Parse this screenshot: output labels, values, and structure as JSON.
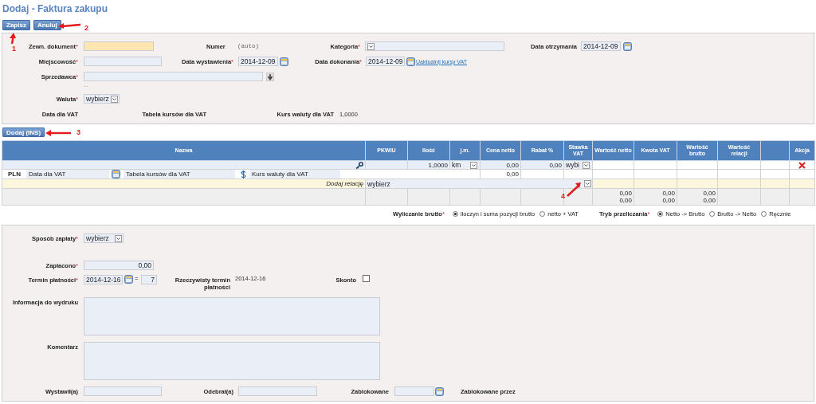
{
  "title": "Dodaj - Faktura zakupu",
  "required_mark": "*",
  "toolbar": [
    {
      "label": "Zapisz"
    },
    {
      "label": "Anuluj"
    }
  ],
  "callouts": [
    {
      "number": "1"
    },
    {
      "number": "2"
    },
    {
      "number": "3"
    },
    {
      "number": "4"
    }
  ],
  "header": {
    "external_document": {
      "label": "Zewn. dokument",
      "required": true
    },
    "number": {
      "label": "Numer",
      "value": "(auto)"
    },
    "category": {
      "label": "Kategoria",
      "required": true
    },
    "received_date": {
      "label": "Data otrzymania",
      "value": "2014-12-09"
    },
    "city": {
      "label": "Miejscowość",
      "required": true
    },
    "issue_date": {
      "label": "Data wystawienia",
      "required": true,
      "value": "2014-12-09"
    },
    "sale_date": {
      "label": "Data dokonania",
      "required": true,
      "value": "2014-12-09"
    },
    "update_rates_link": "Uaktualnij kursy VAT",
    "seller": {
      "label": "Sprzedawca",
      "required": true
    },
    "seller_more": "...",
    "currency": {
      "label": "Waluta",
      "required": true,
      "value": "wybierz"
    },
    "vat_date": {
      "label": "Data dla VAT"
    },
    "vat_rate_table": {
      "label": "Tabela kursów dla VAT"
    },
    "vat_rate": {
      "label": "Kurs waluty dla VAT",
      "value": "1,0000"
    }
  },
  "add_button": "Dodaj (INS)",
  "items_table": {
    "columns": [
      {
        "kind": "text",
        "label": "Nazwa"
      },
      {
        "kind": "text",
        "label": "PKWiU"
      },
      {
        "kind": "text",
        "label": "Ilość"
      },
      {
        "kind": "text",
        "label": "j.m."
      },
      {
        "kind": "text",
        "label": "Cena netto"
      },
      {
        "kind": "text",
        "label": "Rabat %"
      },
      {
        "kind": "text",
        "label": "Stawka VAT"
      },
      {
        "kind": "text",
        "label": "Wartość netto"
      },
      {
        "kind": "text",
        "label": "Kwota VAT"
      },
      {
        "kind": "text",
        "label": "Wartość brutto"
      },
      {
        "kind": "text",
        "label": "Wartość relacji"
      },
      {
        "kind": "blank"
      },
      {
        "kind": "text",
        "label": "Akcja"
      }
    ],
    "item": {
      "quantity": "1,0000",
      "unit": "km",
      "net_price": "0,00",
      "discount": "0,00",
      "vat_rate": "wybi"
    },
    "vat_row": {
      "currency": "PLN",
      "vat_date": {
        "placeholder": "Data dla VAT"
      },
      "rate_table": {
        "placeholder": "Tabela kursów dla VAT"
      },
      "rate": {
        "placeholder": "Kurs waluty dla VAT"
      },
      "net_price": "0,00"
    },
    "relation_row": {
      "label": "Dodaj relację",
      "value": "wybierz"
    },
    "totals": {
      "net": [
        "0,00",
        "0,00"
      ],
      "vat": [
        "0,00",
        "0,00"
      ],
      "gross": [
        "0,00",
        "0,00"
      ]
    }
  },
  "gross_calc": {
    "label": "Wyliczanie brutto",
    "required": true,
    "options": [
      {
        "label": "iloczyn i suma pozycji brutto",
        "selected": true
      },
      {
        "label": "netto + VAT",
        "selected": false
      }
    ]
  },
  "recalc_mode": {
    "label": "Tryb przeliczania",
    "required": true,
    "options": [
      {
        "label": "Netto -> Brutto",
        "selected": true
      },
      {
        "label": "Brutto -> Netto",
        "selected": false
      },
      {
        "label": "Ręcznie",
        "selected": false
      }
    ]
  },
  "payment": {
    "method": {
      "label": "Sposób zapłaty",
      "required": true,
      "value": "wybierz"
    },
    "paid": {
      "label": "Zapłacono",
      "required": true,
      "value": "0,00"
    },
    "due_date": {
      "label": "Termin płatności",
      "required": true,
      "value": "2014-12-16",
      "equals": "=",
      "days": "7"
    },
    "actual_due": {
      "label": "Rzeczywisty termin płatności",
      "value": "2014-12-16"
    },
    "discount": {
      "label": "Skonto",
      "checked": false
    },
    "print_info": {
      "label": "Informacja do wydruku"
    },
    "comment": {
      "label": "Komentarz"
    },
    "issued_by": {
      "label": "Wystawił(a)"
    },
    "received_by": {
      "label": "Odebrał(a)"
    },
    "locked": {
      "label": "Zablokowane"
    },
    "locked_by": {
      "label": "Zablokowane przez"
    }
  }
}
